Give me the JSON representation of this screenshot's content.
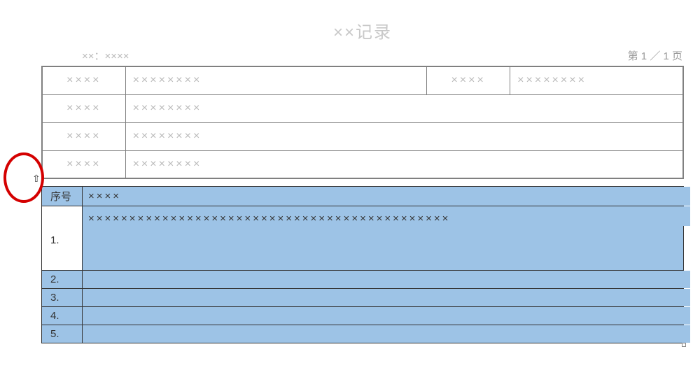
{
  "title": "××记录",
  "header": {
    "left": "××：××××",
    "right": "第 1 ／ 1 页"
  },
  "top_table": {
    "rows": [
      {
        "c1": "××××",
        "c2": "××××××××",
        "c3": "××××",
        "c4": "××××××××",
        "merged": false
      },
      {
        "c1": "××××",
        "c2": "××××××××",
        "merged": true
      },
      {
        "c1": "××××",
        "c2": "××××××××",
        "merged": true
      },
      {
        "c1": "××××",
        "c2": "××××××××",
        "merged": true
      }
    ]
  },
  "bottom_table": {
    "header": {
      "num": "序号",
      "content": "××××"
    },
    "rows": [
      {
        "num": "1.",
        "content": "××××××××××××××××××××××××××××××××××××××××××××"
      },
      {
        "num": "2.",
        "content": ""
      },
      {
        "num": "3.",
        "content": ""
      },
      {
        "num": "4.",
        "content": ""
      },
      {
        "num": "5.",
        "content": ""
      }
    ]
  }
}
